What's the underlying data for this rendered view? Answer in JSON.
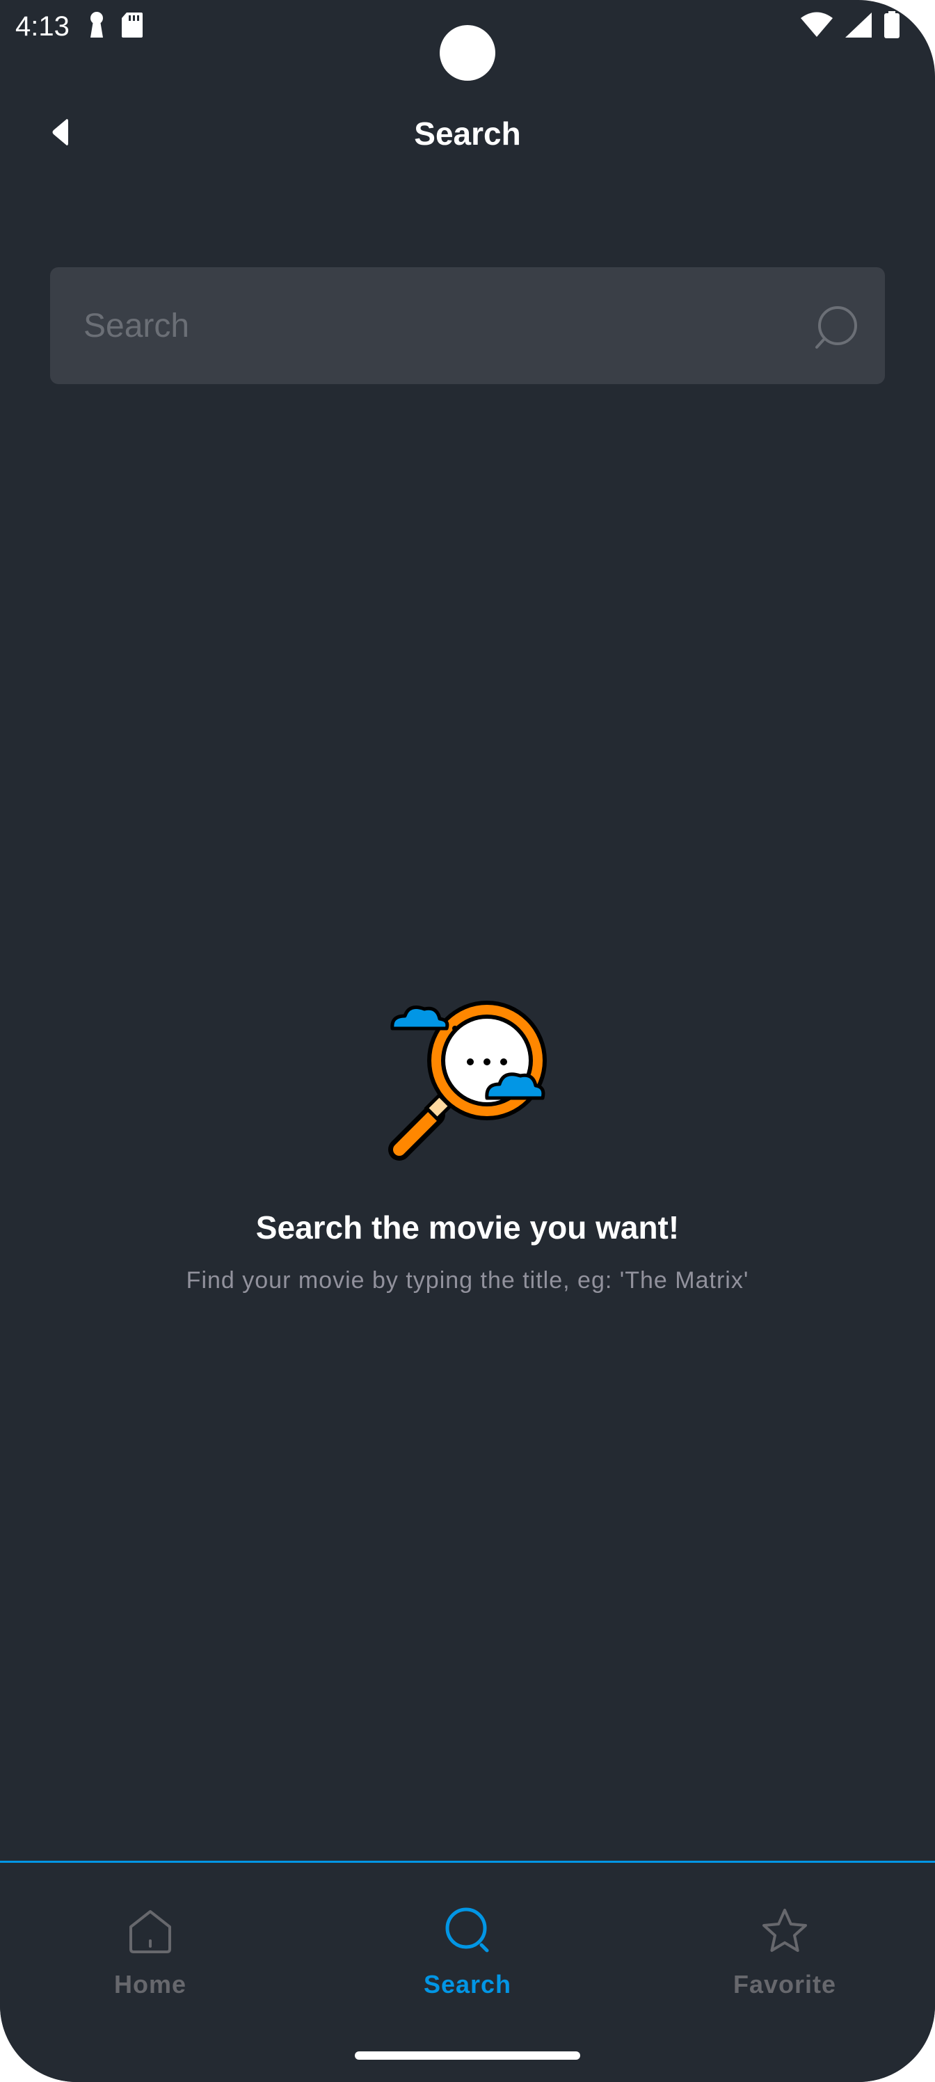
{
  "status_bar": {
    "time": "4:13",
    "left_icons": [
      "keyhole-icon",
      "sd-card-icon"
    ],
    "right_icons": [
      "wifi-icon",
      "signal-icon",
      "battery-icon"
    ]
  },
  "header": {
    "title": "Search",
    "back_icon": "back-arrow-icon"
  },
  "search": {
    "placeholder": "Search",
    "value": "",
    "icon": "search-icon"
  },
  "empty_state": {
    "illustration": "magnifier-with-clouds-illustration",
    "title": "Search the movie you want!",
    "subtitle": "Find your movie by typing the title, eg: 'The Matrix'"
  },
  "bottom_nav": {
    "items": [
      {
        "label": "Home",
        "icon": "home-icon",
        "active": false
      },
      {
        "label": "Search",
        "icon": "search-icon",
        "active": true
      },
      {
        "label": "Favorite",
        "icon": "star-icon",
        "active": false
      }
    ]
  },
  "colors": {
    "background": "#242a32",
    "accent": "#0296e5",
    "input_background": "#3a3f47",
    "inactive": "#67686d",
    "subtitle": "#92929d",
    "illustration_orange": "#ff8700",
    "illustration_blue": "#0296e5"
  }
}
